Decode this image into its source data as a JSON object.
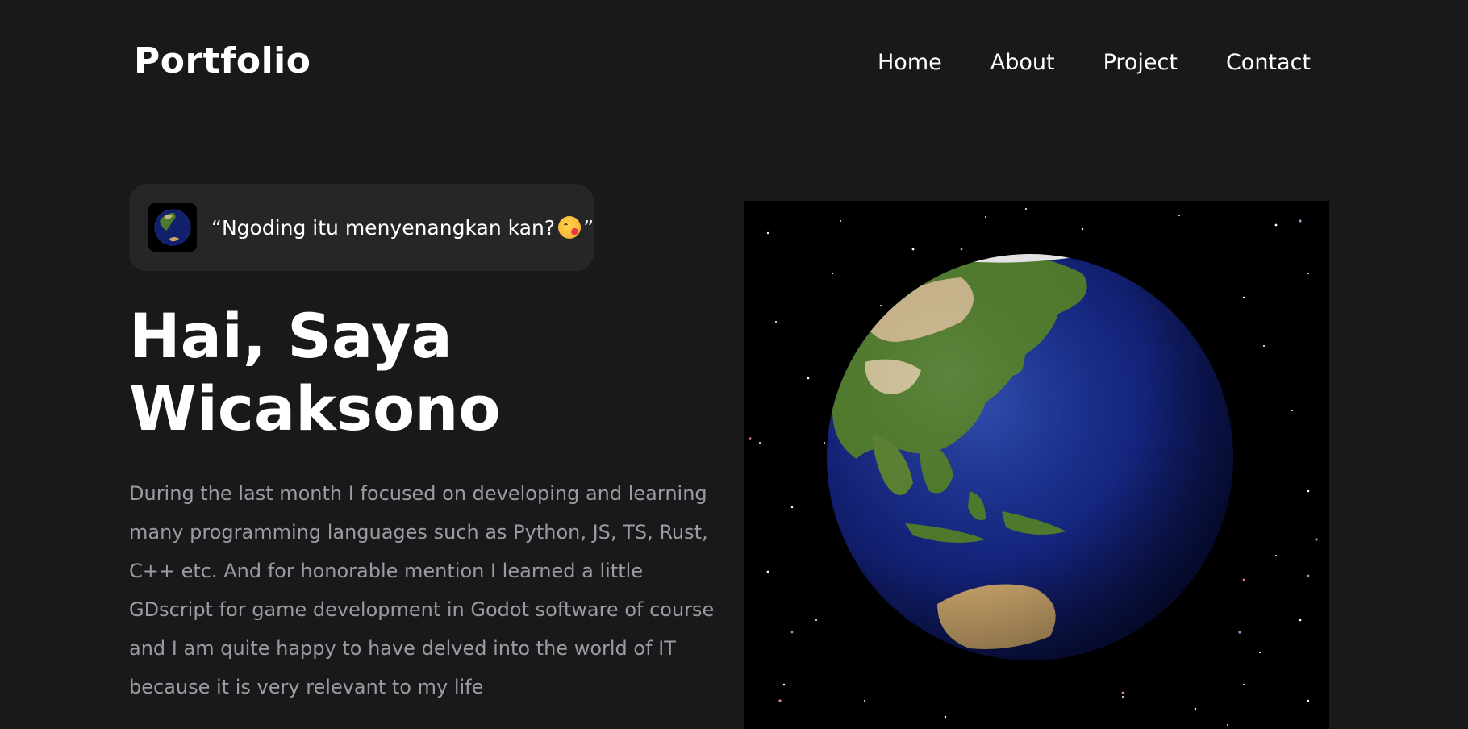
{
  "header": {
    "brand": "Portfolio",
    "nav": [
      {
        "label": "Home"
      },
      {
        "label": "About"
      },
      {
        "label": "Project"
      },
      {
        "label": "Contact"
      }
    ]
  },
  "quote": {
    "text_before": "“Ngoding itu menyenangkan kan?",
    "emoji_icon": "face-blowing-kiss-emoji",
    "text_after": "”"
  },
  "hero": {
    "title_line1": "Hai, Saya",
    "title_line2": "Wicaksono",
    "description": "During the last month I focused on developing and learning many programming languages such as Python, JS, TS, Rust, C++ etc. And for honorable mention I learned a little GDscript for game development in Godot software of course and I am quite happy to have delved into the world of IT because it is very relevant to my life"
  },
  "media": {
    "image_icon": "earth-globe-icon"
  },
  "colors": {
    "background": "#19191b",
    "pill": "#262628",
    "text": "#ffffff",
    "muted_text": "#9c9ca0"
  }
}
